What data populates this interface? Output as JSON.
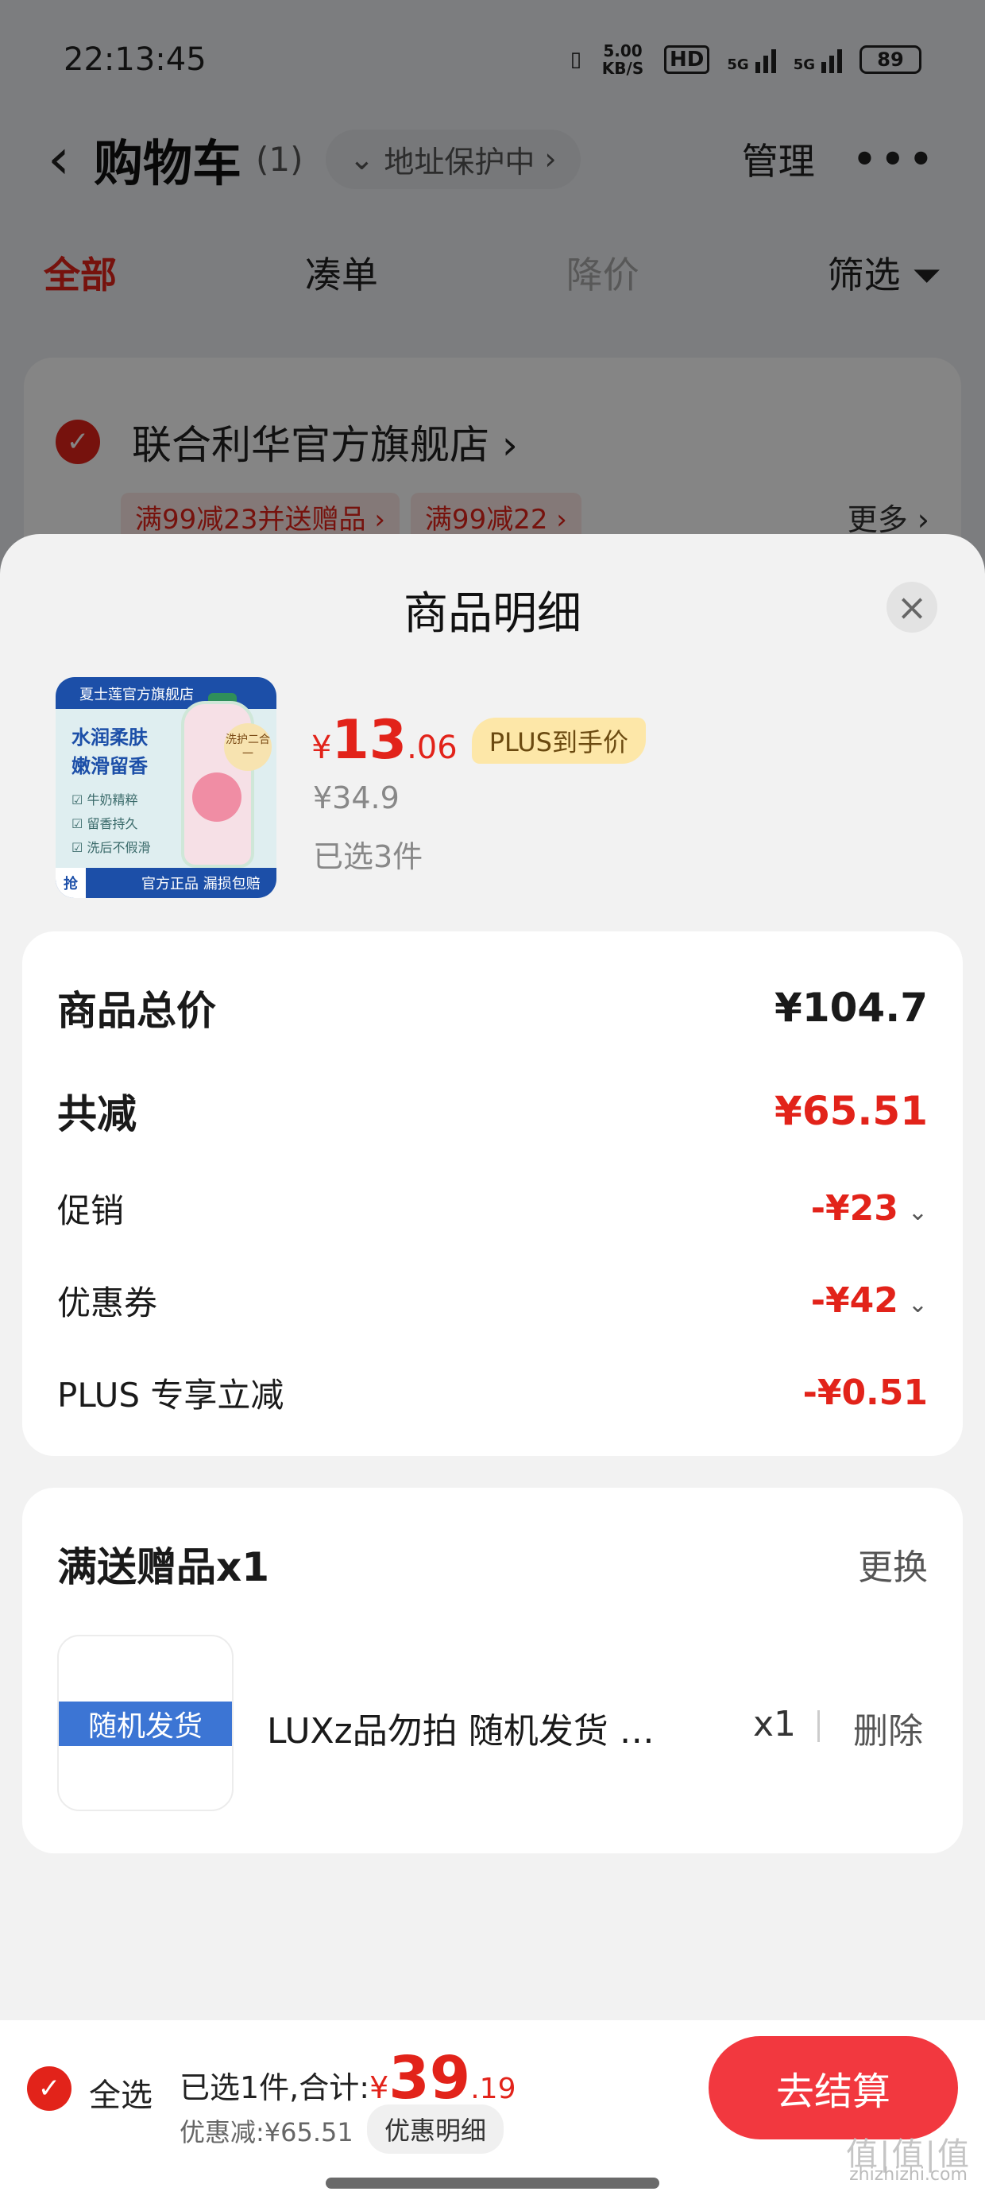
{
  "status_bar": {
    "time": "22:13:45",
    "net_speed": "5.00 KB/S",
    "hd": "HD",
    "sig1": "5G",
    "sig2": "5G",
    "battery": "89"
  },
  "header": {
    "back_icon": "chevron-left-icon",
    "title": "购物车",
    "count": "(1)",
    "address_protect": "地址保护中",
    "manage": "管理",
    "more": "•••"
  },
  "tabs": [
    {
      "label": "全部"
    },
    {
      "label": "凑单"
    },
    {
      "label": "降价"
    },
    {
      "label": "筛选"
    }
  ],
  "store": {
    "name": "联合利华官方旗舰店",
    "promos": [
      "满99减23并送赠品",
      "满99减22"
    ],
    "more": "更多"
  },
  "sheet": {
    "title": "商品明细",
    "product": {
      "image_text": {
        "top": "夏士莲官方旗舰店",
        "slogan1": "水润柔肤",
        "slogan2": "嫩滑留香",
        "b1": "牛奶精粹",
        "b2": "留香持久",
        "b3": "洗后不假滑",
        "badge": "洗护二合一",
        "qiang": "抢",
        "bottom": "官方正品 漏损包赔"
      },
      "price_yen": "¥",
      "price_int": "13",
      "price_dec": ".06",
      "plus_tag": "PLUS到手价",
      "orig_price": "¥34.9",
      "selected": "已选3件"
    },
    "breakdown": {
      "total_label": "商品总价",
      "total_value": "¥104.7",
      "reduce_label": "共减",
      "reduce_value": "¥65.51",
      "promo_label": "促销",
      "promo_value": "-¥23",
      "coupon_label": "优惠券",
      "coupon_value": "-¥42",
      "plus_label": "PLUS 专享立减",
      "plus_value": "-¥0.51"
    },
    "gift": {
      "title": "满送赠品x1",
      "change": "更换",
      "image_label": "随机发货",
      "name": "LUXz品勿拍 随机发货 …",
      "qty": "x1",
      "delete": "删除"
    }
  },
  "bottom_bar": {
    "select_all": "全选",
    "summary_text": "已选1件,合计:",
    "total_yen": "¥",
    "total_int": "39",
    "total_dec": ".19",
    "discount": "优惠减:¥65.51",
    "detail": "优惠明细",
    "checkout": "去结算"
  },
  "watermark": {
    "line1": "值|值|值",
    "line2": "zhizhizhi.com"
  },
  "colors": {
    "accent": "#e2231a",
    "checkout": "#f2383f",
    "gift_strip": "#3c75d4"
  }
}
